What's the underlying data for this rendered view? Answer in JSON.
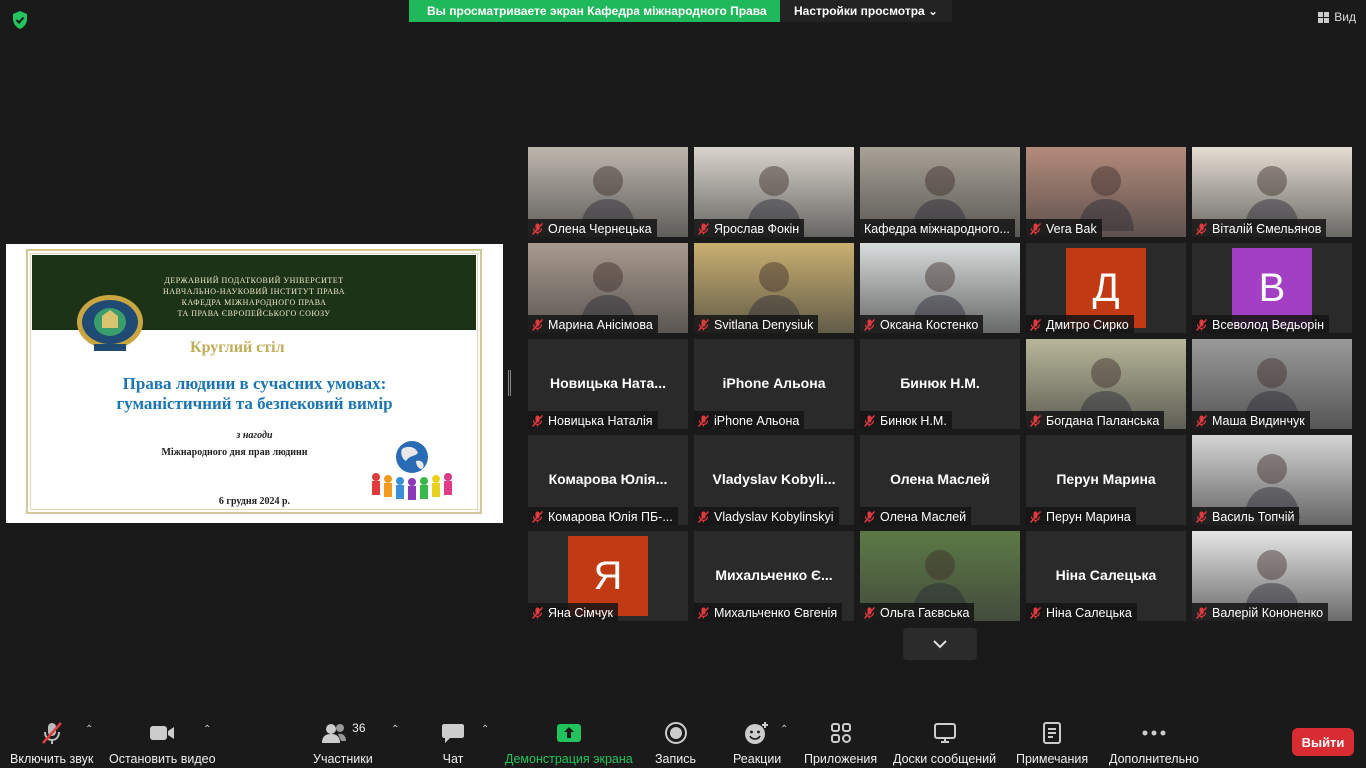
{
  "top": {
    "share_text": "Вы  просматриваете  экран  Кафедра  міжнародного  Права",
    "settings_label": "Настройки просмотра",
    "view_label": "Вид"
  },
  "slide": {
    "header_lines": [
      "ДЕРЖАВНИЙ ПОДАТКОВИЙ УНІВЕРСИТЕТ",
      "НАВЧАЛЬНО-НАУКОВИЙ ІНСТИТУТ ПРАВА",
      "КАФЕДРА МІЖНАРОДНОГО ПРАВА",
      "ТА ПРАВА ЄВРОПЕЙСЬКОГО СОЮЗУ"
    ],
    "round_table": "Круглий стіл",
    "title_line1": "Права людини в сучасних умовах:",
    "title_line2": "гуманістичний та безпековий вимір",
    "occasion": "з нагоди",
    "day": "Міжнародного дня прав людини",
    "date": "6 грудня 2024 р."
  },
  "participants": [
    {
      "name": "Олена Чернецька",
      "kind": "video",
      "bg": "#bdb6ad"
    },
    {
      "name": "Ярослав Фокін",
      "kind": "video",
      "bg": "#d9d4cc"
    },
    {
      "name": "Кафедра міжнародного...",
      "kind": "video",
      "bg": "#a8a196",
      "active": true
    },
    {
      "name": "Vera Bak",
      "kind": "video",
      "bg": "#b48b7c"
    },
    {
      "name": "Віталій Ємельянов",
      "kind": "video",
      "bg": "#e4ddd3"
    },
    {
      "name": "Марина Анісімова",
      "kind": "video",
      "bg": "#a99a8f"
    },
    {
      "name": "Svitlana Denysiuk",
      "kind": "video",
      "bg": "#c9b070"
    },
    {
      "name": "Оксана Костенко",
      "kind": "video",
      "bg": "#d9dcdc"
    },
    {
      "name": "Дмитро Сирко",
      "kind": "letter",
      "letter": "Д",
      "bg": "#c23a14"
    },
    {
      "name": "Всеволод Ведьорін",
      "kind": "letter",
      "letter": "В",
      "bg": "#a23fc4"
    },
    {
      "name": "Новицька Наталія",
      "kind": "text",
      "big": "Новицька  Ната..."
    },
    {
      "name": "iPhone Альона",
      "kind": "text",
      "big": "iPhone Альона"
    },
    {
      "name": "Бинюк Н.М.",
      "kind": "text",
      "big": "Бинюк Н.М."
    },
    {
      "name": "Богдана Паланська",
      "kind": "video",
      "bg": "#b8b79a"
    },
    {
      "name": "Маша Видинчук",
      "kind": "video",
      "bg": "#9a9a9a"
    },
    {
      "name": "Комарова Юлія ПБ-...",
      "kind": "text",
      "big": "Комарова  Юлія..."
    },
    {
      "name": "Vladyslav Kobylinskyi",
      "kind": "text",
      "big": "Vladyslav  Kobyli..."
    },
    {
      "name": "Олена Маслей",
      "kind": "text",
      "big": "Олена Маслей"
    },
    {
      "name": "Перун Марина",
      "kind": "text",
      "big": "Перун Марина"
    },
    {
      "name": "Василь Топчій",
      "kind": "video",
      "bg": "#d4d4d4"
    },
    {
      "name": "Яна Сімчук",
      "kind": "letter",
      "letter": "Я",
      "bg": "#c23a14"
    },
    {
      "name": "Михальченко Євгенія",
      "kind": "text",
      "big": "Михальченко  Є..."
    },
    {
      "name": "Ольга Гаєвська",
      "kind": "video",
      "bg": "#5c7a45"
    },
    {
      "name": "Ніна Салецька",
      "kind": "text",
      "big": "Ніна Салецька"
    },
    {
      "name": "Валерій Кононенко",
      "kind": "video",
      "bg": "#e6e6e6"
    }
  ],
  "toolbar": {
    "mute": "Включить звук",
    "video": "Остановить видео",
    "participants": "Участники",
    "participants_count": "36",
    "chat": "Чат",
    "share": "Демонстрация экрана",
    "record": "Запись",
    "reactions": "Реакции",
    "apps": "Приложения",
    "whiteboards": "Доски сообщений",
    "notes": "Примечания",
    "more": "Дополнительно",
    "leave": "Выйти"
  },
  "colors": {
    "share_green": "#1fb85a",
    "active_border": "#d6e56b",
    "leave_red": "#d82c32",
    "muted_red": "#e0393e"
  }
}
